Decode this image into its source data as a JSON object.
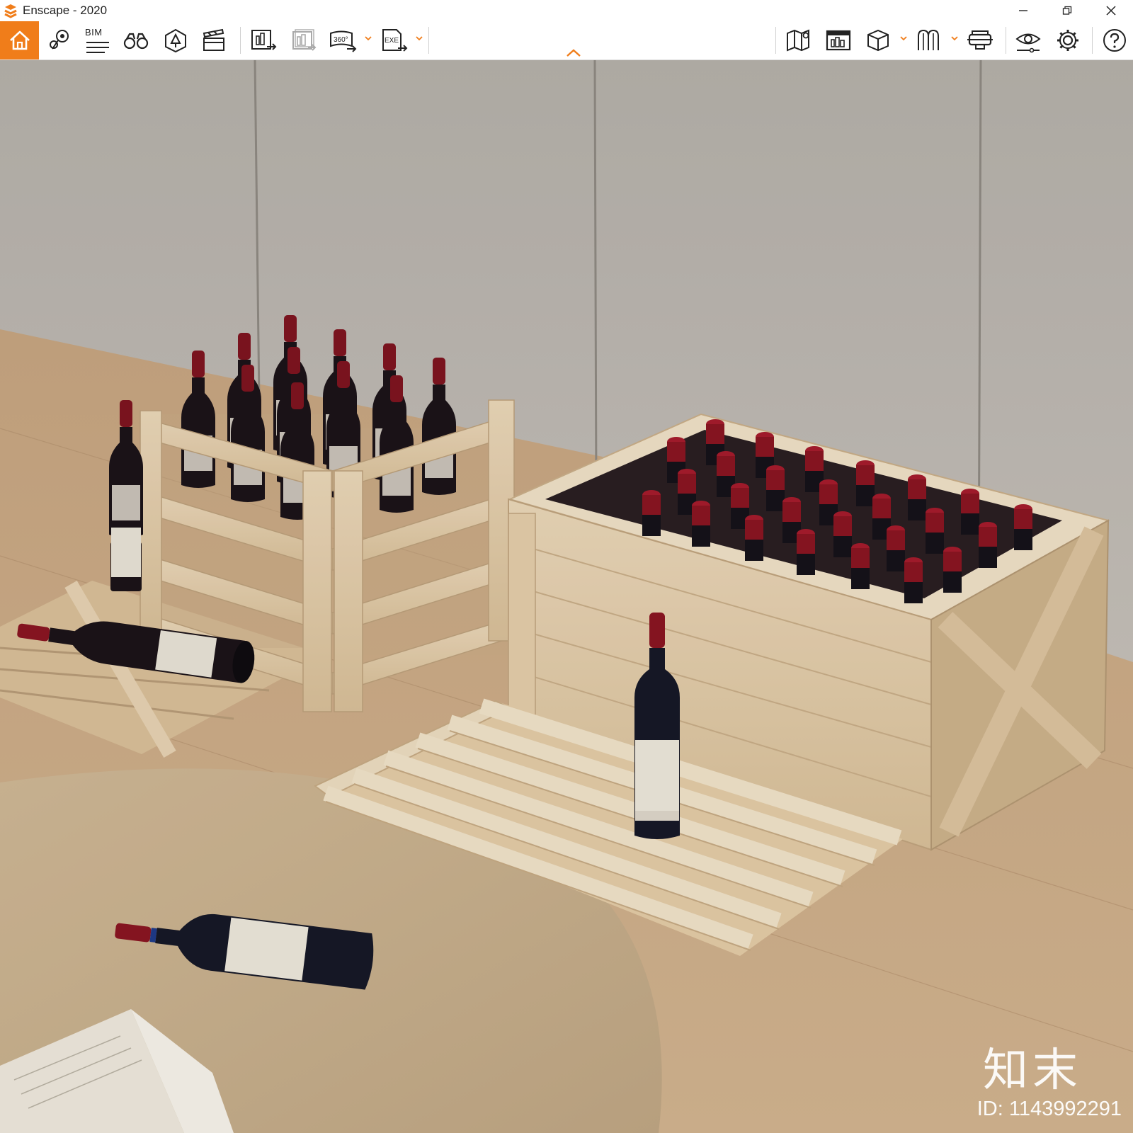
{
  "window": {
    "title": "Enscape - 2020"
  },
  "toolbar": {
    "bim_label": "BIM",
    "buttons": [
      {
        "name": "home-icon"
      },
      {
        "name": "map-pin-icon"
      },
      {
        "name": "bim-info-icon"
      },
      {
        "name": "binoculars-icon"
      },
      {
        "name": "asset-library-icon"
      },
      {
        "name": "video-editor-icon"
      },
      {
        "name": "screenshot-icon"
      },
      {
        "name": "batch-render-icon"
      },
      {
        "name": "panorama-360-icon"
      },
      {
        "name": "exe-export-icon"
      },
      {
        "name": "minimap-icon"
      },
      {
        "name": "web-standalone-icon"
      },
      {
        "name": "view-management-icon"
      },
      {
        "name": "section-icon"
      },
      {
        "name": "vr-headset-icon"
      },
      {
        "name": "visual-settings-icon"
      },
      {
        "name": "settings-gear-icon"
      },
      {
        "name": "help-icon"
      }
    ],
    "icon_360": "360°",
    "icon_exe": "EXE"
  },
  "viewport": {
    "watermark_brand": "知末",
    "watermark_id": "ID: 1143992291"
  },
  "colors": {
    "accent": "#f07d1a",
    "wall": "#bdb8b0",
    "floor": "#c9a886",
    "wood": "#e6cfae",
    "wine": "#8a1522"
  }
}
